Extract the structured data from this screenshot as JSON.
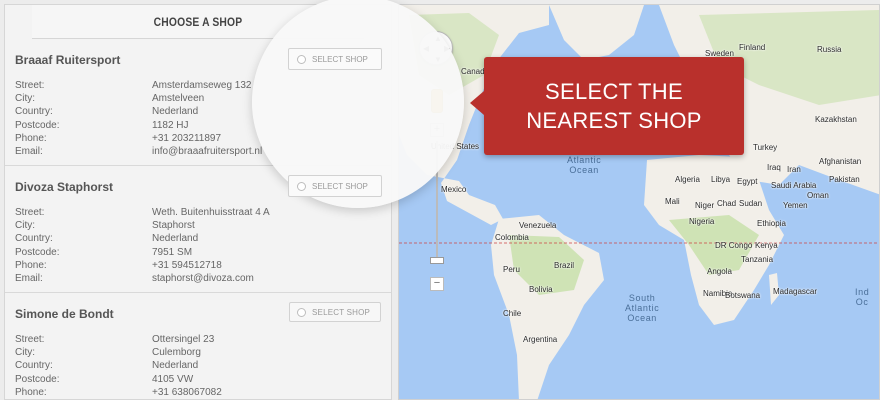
{
  "panel": {
    "title": "CHOOSE A SHOP"
  },
  "labels": {
    "street": "Street:",
    "city": "City:",
    "country": "Country:",
    "postcode": "Postcode:",
    "phone": "Phone:",
    "email": "Email:"
  },
  "shops": [
    {
      "name": "Braaaf Ruitersport",
      "street": "Amsterdamseweg 132",
      "city": "Amstelveen",
      "country": "Nederland",
      "postcode": "1182 HJ",
      "phone": "+31 203211897",
      "email": "info@braaafruitersport.nl",
      "select_label": "SELECT SHOP"
    },
    {
      "name": "Divoza Staphorst",
      "street": "Weth. Buitenhuisstraat 4 A",
      "city": "Staphorst",
      "country": "Nederland",
      "postcode": "7951 SM",
      "phone": "+31 594512718",
      "email": "staphorst@divoza.com",
      "select_label": "SELECT SHOP"
    },
    {
      "name": "Simone de Bondt",
      "street": "Ottersingel 23",
      "city": "Culemborg",
      "country": "Nederland",
      "postcode": "4105 VW",
      "phone": "+31 638067082",
      "select_label": "SELECT SHOP"
    }
  ],
  "callout": {
    "line1": "SELECT THE",
    "line2": "NEAREST SHOP"
  },
  "map": {
    "labels": {
      "canada": "Canada",
      "united_states": "United States",
      "mexico": "Mexico",
      "venezuela": "Venezuela",
      "colombia": "Colombia",
      "peru": "Peru",
      "brazil": "Brazil",
      "bolivia": "Bolivia",
      "chile": "Chile",
      "argentina": "Argentina",
      "russia": "Russia",
      "sweden": "Sweden",
      "finland": "Finland",
      "kazakhstan": "Kazakhstan",
      "turkey": "Turkey",
      "iran": "Iran",
      "iraq": "Iraq",
      "afghanistan": "Afghanistan",
      "pakistan": "Pakistan",
      "egypt": "Egypt",
      "saudi_arabia": "Saudi Arabia",
      "algeria": "Algeria",
      "libya": "Libya",
      "mali": "Mali",
      "niger": "Niger",
      "chad": "Chad",
      "sudan": "Sudan",
      "nigeria": "Nigeria",
      "ethiopia": "Ethiopia",
      "kenya": "Kenya",
      "dr_congo": "DR Congo",
      "tanzania": "Tanzania",
      "angola": "Angola",
      "namibia": "Namibia",
      "botswana": "Botswana",
      "madagascar": "Madagascar",
      "yemen": "Yemen",
      "oman": "Oman"
    },
    "oceans": {
      "atlantic_north_1": "Atlantic",
      "atlantic_north_2": "Ocean",
      "atlantic_south_1": "South",
      "atlantic_south_2": "Atlantic",
      "atlantic_south_3": "Ocean",
      "indian_partial": "Ind",
      "indian_partial_2": "Oc"
    },
    "controls": {
      "zoom_in": "+",
      "zoom_out": "−",
      "zoom_out_2": "−"
    },
    "colors": {
      "water": "#a6c9f4",
      "land": "#f2efe9",
      "green": "#cfe3b5",
      "accent": "#b9302c"
    }
  }
}
